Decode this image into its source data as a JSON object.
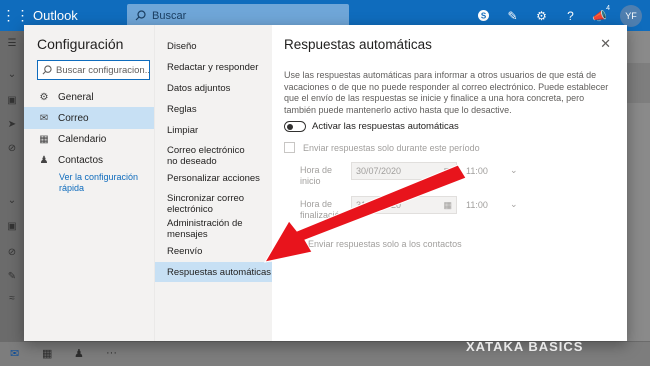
{
  "app": {
    "name": "Outlook"
  },
  "search": {
    "placeholder": "Buscar"
  },
  "topbar": {
    "notification_count": "4",
    "avatar_initials": "YF"
  },
  "settings": {
    "title": "Configuración",
    "search_placeholder": "Buscar configuracion...",
    "nav": [
      {
        "label": "General",
        "icon": "gear-icon"
      },
      {
        "label": "Correo",
        "icon": "mail-icon"
      },
      {
        "label": "Calendario",
        "icon": "calendar-icon"
      },
      {
        "label": "Contactos",
        "icon": "people-icon"
      }
    ],
    "quick_link": "Ver la configuración rápida"
  },
  "submenu": [
    "Diseño",
    "Redactar y responder",
    "Datos adjuntos",
    "Reglas",
    "Limpiar",
    "Correo electrónico no deseado",
    "Personalizar acciones",
    "Sincronizar correo electrónico",
    "Administración de mensajes",
    "Reenvío",
    "Respuestas automáticas"
  ],
  "pane": {
    "title": "Respuestas automáticas",
    "description": "Use las respuestas automáticas para informar a otros usuarios de que está de vacaciones o de que no puede responder al correo electrónico. Puede establecer que el envío de las respuestas se inicie y finalice a una hora concreta, pero también puede mantenerlo activo hasta que lo desactive.",
    "toggle_label": "Activar las respuestas automáticas",
    "toggle_on": false,
    "period_label": "Enviar respuestas solo durante este período",
    "start_label_1": "Hora de",
    "start_label_2": "inicio",
    "start_date": "30/07/2020",
    "start_time": "11:00",
    "end_label_1": "Hora de",
    "end_label_2": "finalización",
    "end_date": "31/07/2020",
    "end_time": "11:00",
    "contacts_label": "Enviar respuestas solo a los contactos"
  },
  "watermark": "XATAKA BASICS",
  "colors": {
    "brand": "#0f6cbd",
    "selected": "#c7e0f4",
    "arrow": "#e8141c"
  }
}
